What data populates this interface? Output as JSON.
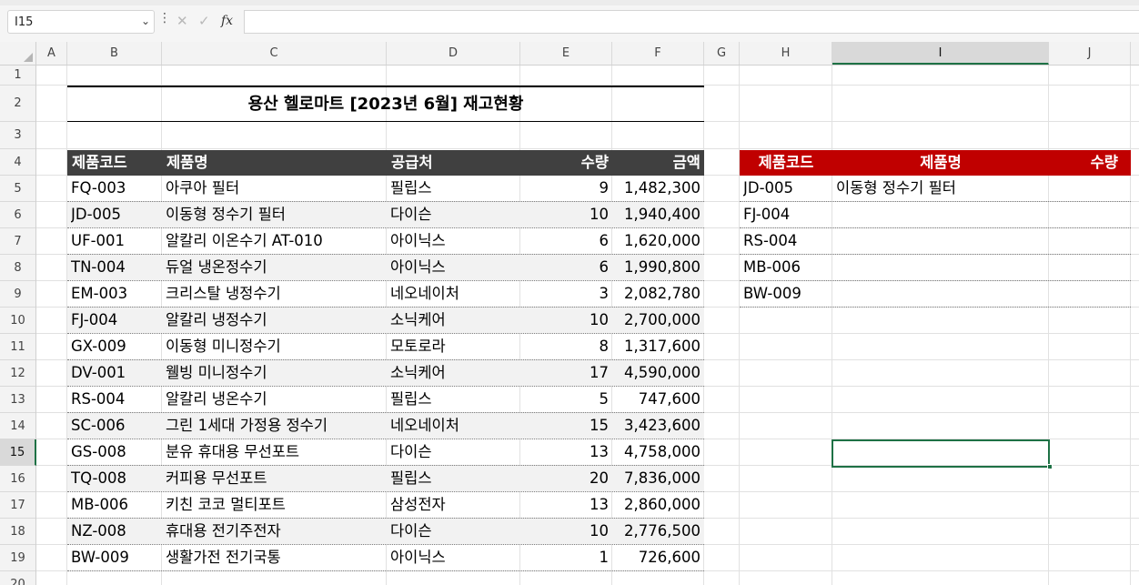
{
  "formula_bar": {
    "name_box": "I15",
    "dots": "⋮",
    "cancel_glyph": "✕",
    "enter_glyph": "✓",
    "fx_glyph": "fx",
    "formula": ""
  },
  "columns": [
    "A",
    "B",
    "C",
    "D",
    "E",
    "F",
    "G",
    "H",
    "I",
    "J"
  ],
  "rows": [
    "1",
    "2",
    "3",
    "4",
    "5",
    "6",
    "7",
    "8",
    "9",
    "10",
    "11",
    "12",
    "13",
    "14",
    "15",
    "16",
    "17",
    "18",
    "19",
    "20"
  ],
  "active_cell": {
    "column": "I",
    "row": "15"
  },
  "title": "용산 헬로마트 [2023년 6월] 재고현황",
  "main_table": {
    "header": [
      "제품코드",
      "제품명",
      "공급처",
      "수량",
      "금액"
    ],
    "rows": [
      [
        "FQ-003",
        "아쿠아 필터",
        "필립스",
        "9",
        "1,482,300"
      ],
      [
        "JD-005",
        "이동형 정수기 필터",
        "다이슨",
        "10",
        "1,940,400"
      ],
      [
        "UF-001",
        "알칼리 이온수기 AT-010",
        "아이닉스",
        "6",
        "1,620,000"
      ],
      [
        "TN-004",
        "듀얼 냉온정수기",
        "아이닉스",
        "6",
        "1,990,800"
      ],
      [
        "EM-003",
        "크리스탈 냉정수기",
        "네오네이처",
        "3",
        "2,082,780"
      ],
      [
        "FJ-004",
        "알칼리 냉정수기",
        "소닉케어",
        "10",
        "2,700,000"
      ],
      [
        "GX-009",
        "이동형 미니정수기",
        "모토로라",
        "8",
        "1,317,600"
      ],
      [
        "DV-001",
        "웰빙 미니정수기",
        "소닉케어",
        "17",
        "4,590,000"
      ],
      [
        "RS-004",
        "알칼리 냉온수기",
        "필립스",
        "5",
        "747,600"
      ],
      [
        "SC-006",
        "그린 1세대 가정용 정수기",
        "네오네이처",
        "15",
        "3,423,600"
      ],
      [
        "GS-008",
        "분유 휴대용 무선포트",
        "다이슨",
        "13",
        "4,758,000"
      ],
      [
        "TQ-008",
        "커피용 무선포트",
        "필립스",
        "20",
        "7,836,000"
      ],
      [
        "MB-006",
        "키친 코코 멀티포트",
        "삼성전자",
        "13",
        "2,860,000"
      ],
      [
        "NZ-008",
        "휴대용 전기주전자",
        "다이슨",
        "10",
        "2,776,500"
      ],
      [
        "BW-009",
        "생활가전 전기국통",
        "아이닉스",
        "1",
        "726,600"
      ]
    ]
  },
  "lookup_table": {
    "header": [
      "제품코드",
      "제품명",
      "수량"
    ],
    "rows": [
      [
        "JD-005",
        "이동형 정수기 필터",
        ""
      ],
      [
        "FJ-004",
        "",
        ""
      ],
      [
        "RS-004",
        "",
        ""
      ],
      [
        "MB-006",
        "",
        ""
      ],
      [
        "BW-009",
        "",
        ""
      ]
    ]
  },
  "colors": {
    "main_header_bg": "#404040",
    "lookup_header_bg": "#c00000",
    "band_alt": "#f2f2f2",
    "selection": "#1e7145"
  }
}
